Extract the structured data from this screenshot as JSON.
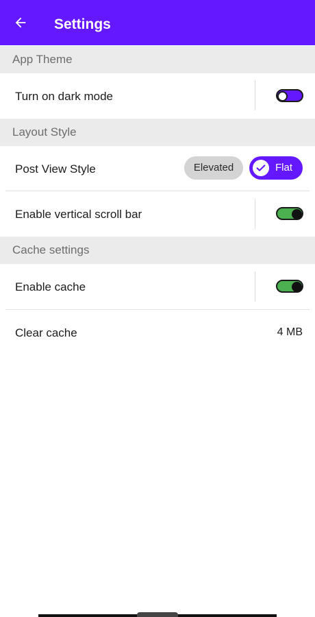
{
  "app_bar": {
    "title": "Settings",
    "back_icon": "arrow-left-icon"
  },
  "sections": {
    "app_theme": {
      "header": "App Theme",
      "dark_mode": {
        "label": "Turn on dark mode",
        "enabled": false
      }
    },
    "layout_style": {
      "header": "Layout Style",
      "post_view_style": {
        "label": "Post View Style",
        "options": [
          "Elevated",
          "Flat"
        ],
        "selected": "Flat"
      },
      "vertical_scroll_bar": {
        "label": "Enable vertical scroll bar",
        "enabled": true
      }
    },
    "cache_settings": {
      "header": "Cache settings",
      "enable_cache": {
        "label": "Enable cache",
        "enabled": true
      },
      "clear_cache": {
        "label": "Clear cache",
        "size": "4 MB"
      }
    }
  },
  "colors": {
    "primary": "#6418ff",
    "switch_on": "#4caf50",
    "section_bg": "#ebebeb"
  }
}
